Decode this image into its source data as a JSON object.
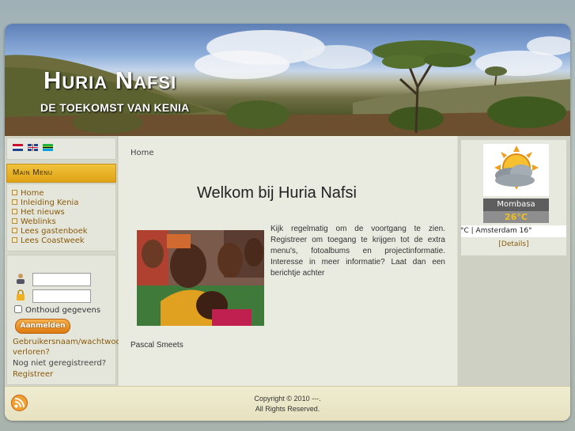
{
  "header": {
    "title": "Huria Nafsi",
    "subtitle": "DE TOEKOMST VAN KENIA"
  },
  "languages": [
    "nl-flag",
    "gb-flag",
    "sw-flag"
  ],
  "main_menu": {
    "title": "Main Menu",
    "items": [
      {
        "label": "Home"
      },
      {
        "label": "Inleiding Kenia"
      },
      {
        "label": "Het nieuws"
      },
      {
        "label": "Weblinks"
      },
      {
        "label": "Lees gastenboek"
      },
      {
        "label": "Lees Coastweek"
      }
    ]
  },
  "login": {
    "remember_label": "Onthoud gegevens",
    "submit_label": "Aanmelden",
    "forgot_link": "Gebruikersnaam/wachtwoord verloren?",
    "not_registered": "Nog niet geregistreerd?",
    "register_link": "Registreer"
  },
  "content": {
    "breadcrumb": "Home",
    "heading": "Welkom bij Huria Nafsi",
    "intro": "Kijk regelmatig om de voortgang te zien. Registreer om toegang te krijgen tot de extra menu's, fotoalbums en projectinformatie. Interesse in meer informatie? Laat dan een berichtje achter",
    "author": "Pascal Smeets"
  },
  "weather": {
    "city": "Mombasa",
    "temperature": "26°C",
    "ticker": "°C | Amsterdam 16°",
    "details": "[Details]",
    "icon": "partly-cloudy-sun-icon"
  },
  "footer": {
    "copyright": "Copyright © 2010 ---.",
    "rights": "All Rights Reserved."
  }
}
